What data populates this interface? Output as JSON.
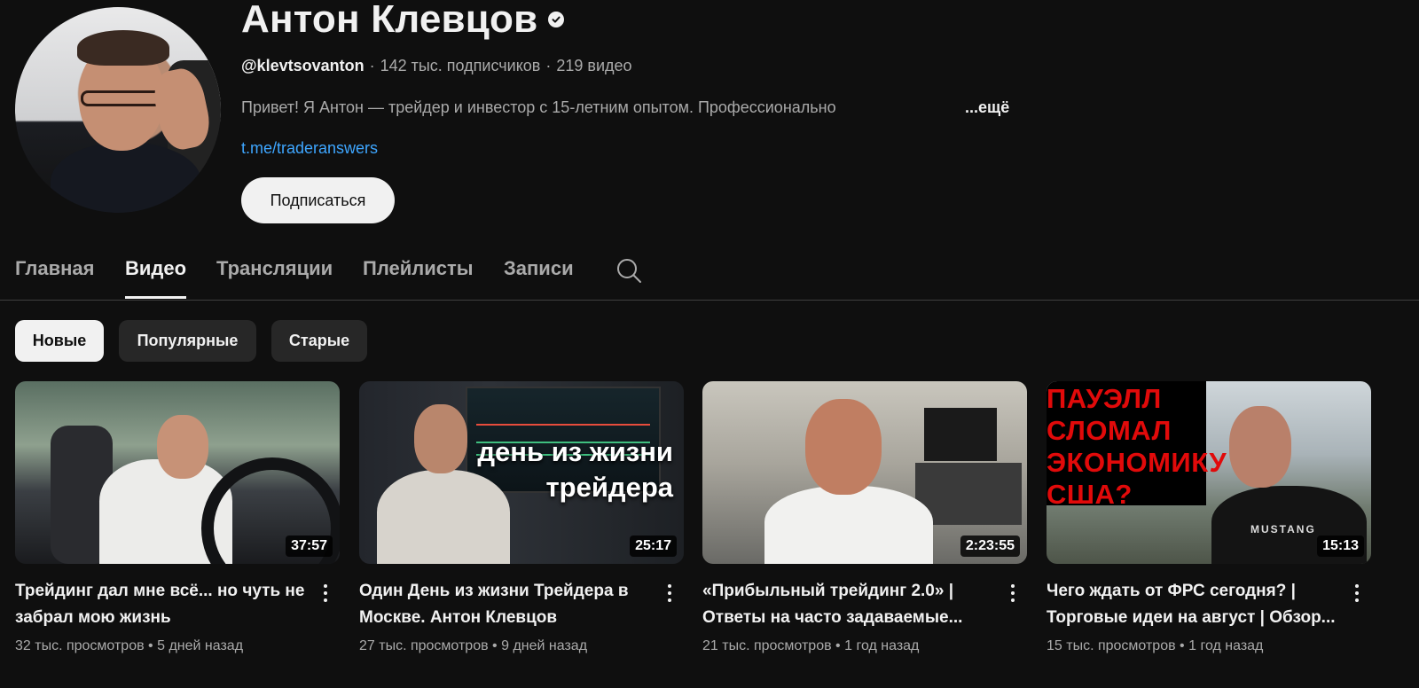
{
  "channel": {
    "name": "Антон Клевцов",
    "handle": "@klevtsovanton",
    "subscribers": "142 тыс. подписчиков",
    "videos_count": "219 видео",
    "separator": "·",
    "description": "Привет! Я Антон — трейдер и инвестор с 15-летним опытом. Профессионально",
    "more_label": "...ещё",
    "link": "t.me/traderanswers",
    "subscribe_label": "Подписаться"
  },
  "tabs": [
    {
      "label": "Главная",
      "active": false
    },
    {
      "label": "Видео",
      "active": true
    },
    {
      "label": "Трансляции",
      "active": false
    },
    {
      "label": "Плейлисты",
      "active": false
    },
    {
      "label": "Записи",
      "active": false
    }
  ],
  "chips": [
    {
      "label": "Новые",
      "selected": true
    },
    {
      "label": "Популярные",
      "selected": false
    },
    {
      "label": "Старые",
      "selected": false
    }
  ],
  "videos": [
    {
      "title": "Трейдинг дал мне всё... но чуть не забрал мою жизнь",
      "duration": "37:57",
      "views": "32 тыс. просмотров",
      "age": "5 дней назад"
    },
    {
      "title": "Один День из жизни Трейдера в Москве. Антон Клевцов",
      "duration": "25:17",
      "views": "27 тыс. просмотров",
      "age": "9 дней назад",
      "thumb_text_1": "день из жизни",
      "thumb_text_2": "трейдера"
    },
    {
      "title": "«Прибыльный трейдинг 2.0» | Ответы на часто задаваемые...",
      "duration": "2:23:55",
      "views": "21 тыс. просмотров",
      "age": "1 год назад"
    },
    {
      "title": "Чего ждать от ФРС сегодня? | Торговые идеи на август | Обзор...",
      "duration": "15:13",
      "views": "15 тыс. просмотров",
      "age": "1 год назад",
      "thumb_text_1": "ПАУЭЛЛ",
      "thumb_text_2": "СЛОМАЛ",
      "thumb_text_3": "ЭКОНОМИКУ",
      "thumb_text_4": "США?",
      "thumb_logo": "MUSTANG"
    }
  ],
  "stats_separator": "•",
  "colors": {
    "background": "#0f0f0f",
    "text": "#f1f1f1",
    "muted": "#aaaaaa",
    "link": "#3ea6ff",
    "chip": "#272727"
  }
}
